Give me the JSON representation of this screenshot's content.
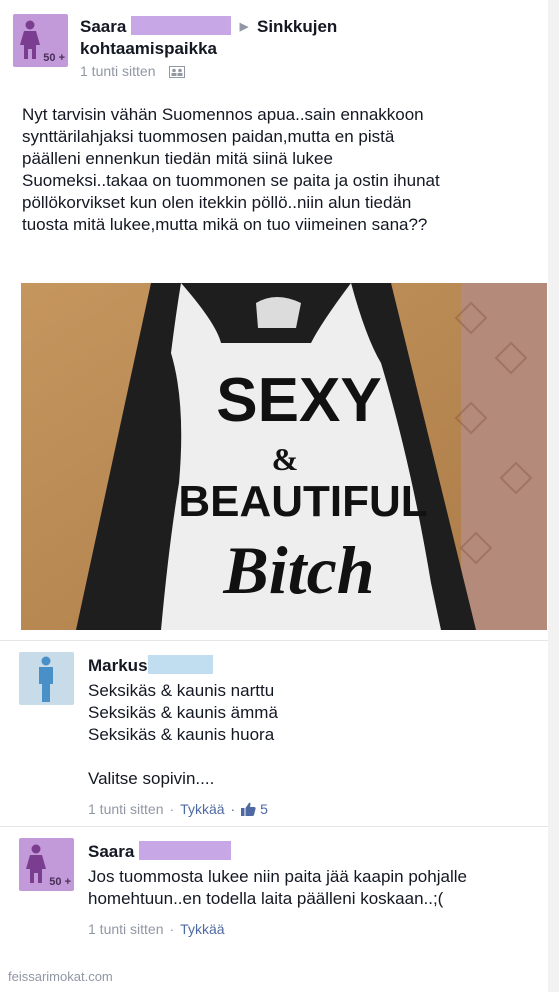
{
  "post": {
    "author_name": "Saara",
    "group_name": "Sinkkujen kohtaamispaikka",
    "age_badge": "50 +",
    "timestamp": "1 tunti sitten",
    "privacy_icon": "friends-icon",
    "text": "Nyt tarvisin vähän Suomennos apua..sain ennakkoon synttärilahjaksi tuommosen paidan,mutta en pistä päälleni ennenkun tiedän mitä siinä lukee Suomeksi..takaa on tuommonen se paita ja ostin ihunat pöllökorvikset kun olen itekkin pöllö..niin alun tiedän tuosta mitä lukee,mutta mikä on tuo viimeinen sana??",
    "photo": {
      "line1": "SEXY",
      "line2": "&",
      "line3": "BEAUTIFUL",
      "line4": "Bitch"
    }
  },
  "comments": [
    {
      "author": "Markus",
      "lines": [
        "Seksikäs & kaunis narttu",
        "Seksikäs & kaunis ämmä",
        "Seksikäs & kaunis huora",
        "",
        "Valitse sopivin...."
      ],
      "time": "1 tunti sitten",
      "like_label": "Tykkää",
      "like_count": "5"
    },
    {
      "author": "Saara",
      "age_badge": "50 +",
      "text": "Jos tuommosta lukee niin paita jää kaapin pohjalle homehtuun..en todella laita päälleni koskaan..;(",
      "time": "1 tunti sitten",
      "like_label": "Tykkää"
    }
  ],
  "watermark": "feissarimokat.com",
  "colors": {
    "female_avatar": "#c39ad9",
    "male_avatar": "#c8dbe8",
    "link": "#4e69a2",
    "meta": "#9197a3"
  }
}
